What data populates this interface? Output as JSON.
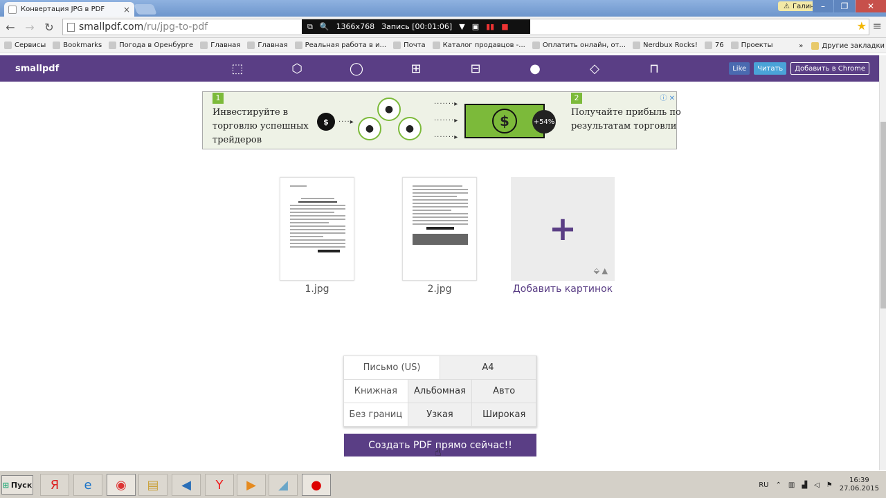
{
  "browser": {
    "tab_title": "Конвертация JPG в PDF",
    "user": "Галина",
    "url_domain": "smallpdf.com",
    "url_path": "/ru/jpg-to-pdf",
    "recorder": {
      "resolution": "1366x768",
      "status": "Запись [00:01:06]"
    }
  },
  "bookmarks": {
    "items": [
      "Сервисы",
      "Bookmarks",
      "Погода в Оренбурге",
      "Главная",
      "Главная",
      "Реальная работа в и...",
      "Почта",
      "Каталог продавцов -...",
      "Оплатить онлайн, от...",
      "Nerdbux Rocks!",
      "76",
      "Проекты"
    ],
    "more": "»",
    "other": "Другие закладки"
  },
  "site": {
    "logo": "smallpdf",
    "social": {
      "like": "Like",
      "follow": "Читать",
      "chrome": "Добавить в Chrome"
    }
  },
  "ad": {
    "step1": "1",
    "text1": "Инвестируйте в торговлю успешных трейдеров",
    "step2": "2",
    "text2": "Получайте прибыль по результатам торговли",
    "percent": "+54%",
    "close": "ⓘ ✕"
  },
  "files": [
    {
      "name": "1.jpg"
    },
    {
      "name": "2.jpg"
    }
  ],
  "add_label": "Добавить картинок",
  "options": {
    "row1": [
      "Письмо (US)",
      "A4"
    ],
    "row2": [
      "Книжная",
      "Альбомная",
      "Авто"
    ],
    "row3": [
      "Без границ",
      "Узкая",
      "Широкая"
    ]
  },
  "create_button": "Создать PDF прямо сейчас!!",
  "taskbar": {
    "start": "Пуск",
    "lang": "RU",
    "time": "16:39",
    "date": "27.06.2015"
  }
}
